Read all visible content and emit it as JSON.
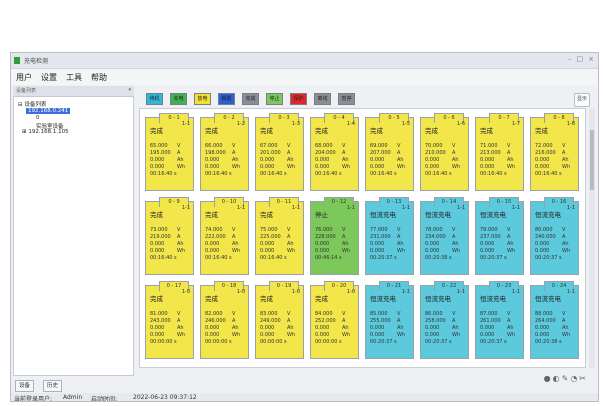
{
  "window": {
    "title": "充电检测",
    "controls": [
      "–",
      "□",
      "×"
    ],
    "icon_color": "#2f9e3a"
  },
  "menu": [
    "用户",
    "设置",
    "工具",
    "帮助"
  ],
  "sidebar": {
    "header": "设备列表",
    "tree": [
      {
        "text": "⊟ 设备列表",
        "indent": 0,
        "selected": false
      },
      {
        "text": "192.168.0.241",
        "indent": 1,
        "selected": true
      },
      {
        "text": "0",
        "indent": 2,
        "selected": false
      },
      {
        "text": "实验室设备",
        "indent": 2,
        "selected": false
      },
      {
        "text": "⊞ 192.168.1.105",
        "indent": 1,
        "selected": false
      }
    ],
    "tabs": [
      "设备",
      "历史"
    ]
  },
  "toolbar": {
    "buttons": [
      {
        "label": "待机",
        "color": "#2fb7d8"
      },
      {
        "label": "充电",
        "color": "#3eb34f"
      },
      {
        "label": "放电",
        "color": "#f2e230"
      },
      {
        "label": "搁置",
        "color": "#2b5fd6"
      },
      {
        "label": "完成",
        "color": "#8a8f96"
      },
      {
        "label": "停止",
        "color": "#7cc85a"
      },
      {
        "label": "保护",
        "color": "#e0262b"
      },
      {
        "label": "离线",
        "color": "#8a8f96"
      },
      {
        "label": "暂停",
        "color": "#8a8f96"
      }
    ],
    "right_button": "显示"
  },
  "channels": [
    {
      "id": "0 - 1",
      "ch": "1-1",
      "status": "完成",
      "color": "#f2e64a",
      "v": "65.000",
      "c": "195.000",
      "cap": "0.000",
      "e": "0.000",
      "t": "00:16:40 s"
    },
    {
      "id": "0 - 2",
      "ch": "1-2",
      "status": "完成",
      "color": "#f2e64a",
      "v": "66.000",
      "c": "198.000",
      "cap": "0.000",
      "e": "0.000",
      "t": "00:16:40 s"
    },
    {
      "id": "0 - 3",
      "ch": "1-3",
      "status": "完成",
      "color": "#f2e64a",
      "v": "67.000",
      "c": "201.000",
      "cap": "0.000",
      "e": "0.000",
      "t": "00:16:40 s"
    },
    {
      "id": "0 - 4",
      "ch": "1-4",
      "status": "完成",
      "color": "#f2e64a",
      "v": "68.000",
      "c": "204.000",
      "cap": "0.000",
      "e": "0.000",
      "t": "00:16:40 s"
    },
    {
      "id": "0 - 5",
      "ch": "1-5",
      "status": "完成",
      "color": "#f2e64a",
      "v": "69.000",
      "c": "207.000",
      "cap": "0.000",
      "e": "0.000",
      "t": "00:16:40 s"
    },
    {
      "id": "0 - 6",
      "ch": "1-6",
      "status": "完成",
      "color": "#f2e64a",
      "v": "70.000",
      "c": "210.000",
      "cap": "0.000",
      "e": "0.000",
      "t": "00:16:40 s"
    },
    {
      "id": "0 - 7",
      "ch": "1-7",
      "status": "完成",
      "color": "#f2e64a",
      "v": "71.000",
      "c": "213.000",
      "cap": "0.000",
      "e": "0.000",
      "t": "00:16:40 s"
    },
    {
      "id": "0 - 8",
      "ch": "1-8",
      "status": "完成",
      "color": "#f2e64a",
      "v": "72.000",
      "c": "216.000",
      "cap": "0.000",
      "e": "0.000",
      "t": "00:16:40 s"
    },
    {
      "id": "0 - 9",
      "ch": "1-1",
      "status": "完成",
      "color": "#f2e64a",
      "v": "73.000",
      "c": "219.000",
      "cap": "0.000",
      "e": "0.000",
      "t": "00:16:40 s"
    },
    {
      "id": "0 - 10",
      "ch": "1-1",
      "status": "完成",
      "color": "#f2e64a",
      "v": "74.000",
      "c": "222.000",
      "cap": "0.000",
      "e": "0.000",
      "t": "00:16:40 s"
    },
    {
      "id": "0 - 11",
      "ch": "1-1",
      "status": "完成",
      "color": "#f2e64a",
      "v": "75.000",
      "c": "225.000",
      "cap": "0.000",
      "e": "0.000",
      "t": "00:16:40 s"
    },
    {
      "id": "0 - 12",
      "ch": "1-1",
      "status": "停止",
      "color": "#7cc85a",
      "v": "76.000",
      "c": "228.000",
      "cap": "0.000",
      "e": "0.000",
      "t": "00:46:14 s"
    },
    {
      "id": "0 - 13",
      "ch": "1-1",
      "status": "恒流充电",
      "color": "#5cc9dc",
      "v": "77.000",
      "c": "231.000",
      "cap": "0.000",
      "e": "0.000",
      "t": "00:20:37 s"
    },
    {
      "id": "0 - 14",
      "ch": "1-1",
      "status": "恒流充电",
      "color": "#5cc9dc",
      "v": "78.000",
      "c": "234.000",
      "cap": "0.000",
      "e": "0.000",
      "t": "00:20:38 s"
    },
    {
      "id": "0 - 15",
      "ch": "1-1",
      "status": "恒流充电",
      "color": "#5cc9dc",
      "v": "79.000",
      "c": "237.000",
      "cap": "0.000",
      "e": "0.000",
      "t": "00:20:37 s"
    },
    {
      "id": "0 - 16",
      "ch": "1-1",
      "status": "恒流充电",
      "color": "#5cc9dc",
      "v": "80.000",
      "c": "240.000",
      "cap": "0.000",
      "e": "0.000",
      "t": "00:20:37 s"
    },
    {
      "id": "0 - 17",
      "ch": "1-0",
      "status": "完成",
      "color": "#f2e64a",
      "v": "81.000",
      "c": "243.000",
      "cap": "0.000",
      "e": "0.000",
      "t": "00:00:00 s"
    },
    {
      "id": "0 - 18",
      "ch": "1-0",
      "status": "完成",
      "color": "#f2e64a",
      "v": "82.000",
      "c": "246.000",
      "cap": "0.000",
      "e": "0.000",
      "t": "00:00:00 s"
    },
    {
      "id": "0 - 19",
      "ch": "1-0",
      "status": "完成",
      "color": "#f2e64a",
      "v": "83.000",
      "c": "249.000",
      "cap": "0.000",
      "e": "0.000",
      "t": "00:00:00 s"
    },
    {
      "id": "0 - 20",
      "ch": "1-0",
      "status": "完成",
      "color": "#f2e64a",
      "v": "84.000",
      "c": "252.000",
      "cap": "0.000",
      "e": "0.000",
      "t": "00:00:00 s"
    },
    {
      "id": "0 - 21",
      "ch": "1-1",
      "status": "恒流充电",
      "color": "#5cc9dc",
      "v": "85.000",
      "c": "255.000",
      "cap": "0.000",
      "e": "0.000",
      "t": "00:20:37 s"
    },
    {
      "id": "0 - 22",
      "ch": "1-1",
      "status": "恒流充电",
      "color": "#5cc9dc",
      "v": "86.000",
      "c": "258.000",
      "cap": "0.000",
      "e": "0.000",
      "t": "00:20:37 s"
    },
    {
      "id": "0 - 23",
      "ch": "1-1",
      "status": "恒流充电",
      "color": "#5cc9dc",
      "v": "87.000",
      "c": "261.000",
      "cap": "0.000",
      "e": "0.000",
      "t": "00:20:37 s"
    },
    {
      "id": "0 - 24",
      "ch": "1-1",
      "status": "恒流充电",
      "color": "#5cc9dc",
      "v": "88.000",
      "c": "264.000",
      "cap": "0.000",
      "e": "0.000",
      "t": "00:20:38 s"
    }
  ],
  "units": {
    "voltage": "V",
    "current": "A",
    "capacity": "Ah",
    "energy": "Wh"
  },
  "status_bar": {
    "user_label": "当前登录用户:",
    "user": "Admin",
    "time_label": "启动时间:",
    "time": "2022-06-23 09:37:12"
  },
  "bottom_icons": [
    "●",
    "◐",
    "✎",
    "◔",
    "✂"
  ]
}
